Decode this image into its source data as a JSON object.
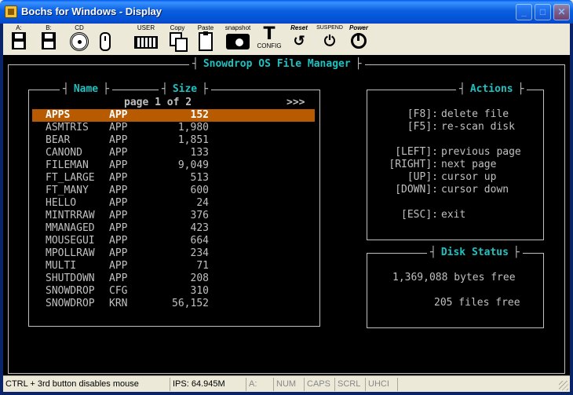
{
  "window": {
    "title": "Bochs for Windows - Display",
    "buttons": {
      "minimize": "_",
      "maximize": "□",
      "close": "✕"
    }
  },
  "toolbar": {
    "a_label": "A:",
    "b_label": "B:",
    "cd_label": "CD",
    "user_label": "USER",
    "copy_label": "Copy",
    "paste_label": "Paste",
    "snapshot_label": "snapshot",
    "config_label": "CONFIG",
    "reset_label": "Reset",
    "suspend_label": "SUSPEND",
    "power_label": "Power"
  },
  "app": {
    "title": "Snowdrop OS File Manager",
    "files_panel": {
      "name_header": "Name",
      "size_header": "Size",
      "page_indicator": "page 1 of 2",
      "next_indicator": ">>>",
      "files": [
        {
          "name": "APPS",
          "ext": "APP",
          "size": "152"
        },
        {
          "name": "ASMTRIS",
          "ext": "APP",
          "size": "1,980"
        },
        {
          "name": "BEAR",
          "ext": "APP",
          "size": "1,851"
        },
        {
          "name": "CANOND",
          "ext": "APP",
          "size": "133"
        },
        {
          "name": "FILEMAN",
          "ext": "APP",
          "size": "9,049"
        },
        {
          "name": "FT_LARGE",
          "ext": "APP",
          "size": "513"
        },
        {
          "name": "FT_MANY",
          "ext": "APP",
          "size": "600"
        },
        {
          "name": "HELLO",
          "ext": "APP",
          "size": "24"
        },
        {
          "name": "MINTRRAW",
          "ext": "APP",
          "size": "376"
        },
        {
          "name": "MMANAGED",
          "ext": "APP",
          "size": "423"
        },
        {
          "name": "MOUSEGUI",
          "ext": "APP",
          "size": "664"
        },
        {
          "name": "MPOLLRAW",
          "ext": "APP",
          "size": "234"
        },
        {
          "name": "MULTI",
          "ext": "APP",
          "size": "71"
        },
        {
          "name": "SHUTDOWN",
          "ext": "APP",
          "size": "208"
        },
        {
          "name": "SNOWDROP",
          "ext": "CFG",
          "size": "310"
        },
        {
          "name": "SNOWDROP",
          "ext": "KRN",
          "size": "56,152"
        }
      ],
      "selected_index": 0
    },
    "actions_panel": {
      "title": "Actions",
      "items": [
        {
          "key": "[F8]:",
          "desc": "delete file"
        },
        {
          "key": "[F5]:",
          "desc": "re-scan disk"
        },
        {
          "key": "[LEFT]:",
          "desc": "previous page"
        },
        {
          "key": "[RIGHT]:",
          "desc": "next page"
        },
        {
          "key": "[UP]:",
          "desc": "cursor up"
        },
        {
          "key": "[DOWN]:",
          "desc": "cursor down"
        },
        {
          "key": "[ESC]:",
          "desc": "exit"
        }
      ]
    },
    "disk_status": {
      "title": "Disk Status",
      "bytes_free": "1,369,088 bytes free",
      "files_free": "205 files free"
    }
  },
  "statusbar": {
    "hint": "CTRL + 3rd button disables mouse",
    "ips": "IPS: 64.945M",
    "drive": "A:",
    "num": "NUM",
    "caps": "CAPS",
    "scrl": "SCRL",
    "uhci": "UHCI"
  }
}
